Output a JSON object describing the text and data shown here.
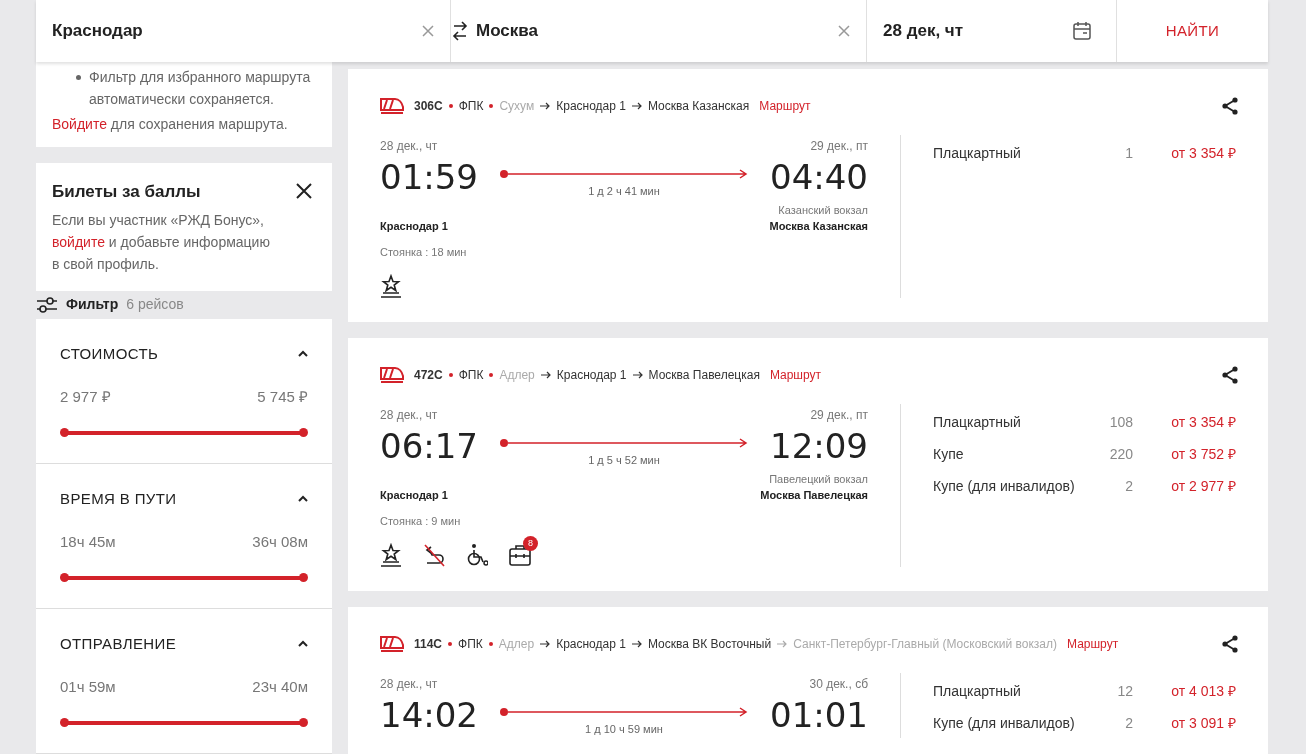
{
  "search": {
    "from": "Краснодар",
    "to": "Москва",
    "date": "28 дек, чт",
    "button": "НАЙТИ"
  },
  "sidebar": {
    "saved_route_note": {
      "bullet": "Фильтр для избранного маршрута автоматически сохраняется.",
      "login_link": "Войдите",
      "login_text": " для сохранения маршрута."
    },
    "bonus_card": {
      "title": "Билеты за баллы",
      "text_before": "Если вы участник «РЖД Бонус»,",
      "link": "войдите",
      "text_after": " и добавьте информацию в свой профиль."
    },
    "filter": {
      "label": "Фильтр",
      "count": "6 рейсов"
    },
    "filter_sections": [
      {
        "title": "СТОИМОСТЬ",
        "expanded": true,
        "min": "2 977 ₽",
        "max": "5 745 ₽",
        "level": 1
      },
      {
        "title": "ВРЕМЯ В ПУТИ",
        "expanded": true,
        "min": "18ч 45м",
        "max": "36ч 08м",
        "level": 1
      },
      {
        "title": "ОТПРАВЛЕНИЕ",
        "expanded": true,
        "min": "01ч 59м",
        "max": "23ч 40м",
        "level": 1
      }
    ]
  },
  "trains": [
    {
      "number": "306С",
      "carrier": "ФПК",
      "route": [
        {
          "name": "Сухум",
          "kind": "outer"
        },
        {
          "name": "Краснодар 1",
          "kind": "main"
        },
        {
          "name": "Москва Казанская",
          "kind": "main"
        }
      ],
      "route_link": "Маршрут",
      "dep_date": "28 дек., чт",
      "dep_time": "01:59",
      "duration": "1 д 2 ч 41 мин",
      "arr_date": "29 дек., пт",
      "arr_time": "04:40",
      "arr_note": "Казанский вокзал",
      "dep_station": "Краснодар 1",
      "arr_station": "Москва Казанская",
      "stop": "Стоянка : 18 мин",
      "features": [
        {
          "kind": "star"
        }
      ],
      "classes": [
        {
          "name": "Плацкартный",
          "seats": "1",
          "price": "от 3 354 ₽"
        }
      ]
    },
    {
      "number": "472С",
      "carrier": "ФПК",
      "route": [
        {
          "name": "Адлер",
          "kind": "outer"
        },
        {
          "name": "Краснодар 1",
          "kind": "main"
        },
        {
          "name": "Москва Павелецкая",
          "kind": "main"
        }
      ],
      "route_link": "Маршрут",
      "dep_date": "28 дек., чт",
      "dep_time": "06:17",
      "duration": "1 д 5 ч 52 мин",
      "arr_date": "29 дек., пт",
      "arr_time": "12:09",
      "arr_note": "Павелецкий вокзал",
      "dep_station": "Краснодар 1",
      "arr_station": "Москва Павелецкая",
      "stop": "Стоянка : 9 мин",
      "features": [
        {
          "kind": "star"
        },
        {
          "kind": "crossed"
        },
        {
          "kind": "wheelchair"
        },
        {
          "kind": "case",
          "badge": "8"
        }
      ],
      "classes": [
        {
          "name": "Плацкартный",
          "seats": "108",
          "price": "от 3 354 ₽"
        },
        {
          "name": "Купе",
          "seats": "220",
          "price": "от 3 752 ₽"
        },
        {
          "name": "Купе (для инвалидов)",
          "seats": "2",
          "price": "от 2 977 ₽"
        }
      ]
    },
    {
      "number": "114С",
      "carrier": "ФПК",
      "route": [
        {
          "name": "Адлер",
          "kind": "outer"
        },
        {
          "name": "Краснодар 1",
          "kind": "main"
        },
        {
          "name": "Москва ВК Восточный",
          "kind": "main"
        },
        {
          "name": "Санкт-Петербург-Главный (Московский вокзал)",
          "kind": "outer"
        }
      ],
      "route_link": "Маршрут",
      "dep_date": "28 дек., чт",
      "dep_time": "14:02",
      "duration": "1 д 10 ч 59 мин",
      "arr_date": "30 дек., сб",
      "arr_time": "01:01",
      "classes": [
        {
          "name": "Плацкартный",
          "seats": "12",
          "price": "от 4 013 ₽"
        },
        {
          "name": "Купе (для инвалидов)",
          "seats": "2",
          "price": "от 3 091 ₽"
        }
      ]
    }
  ]
}
